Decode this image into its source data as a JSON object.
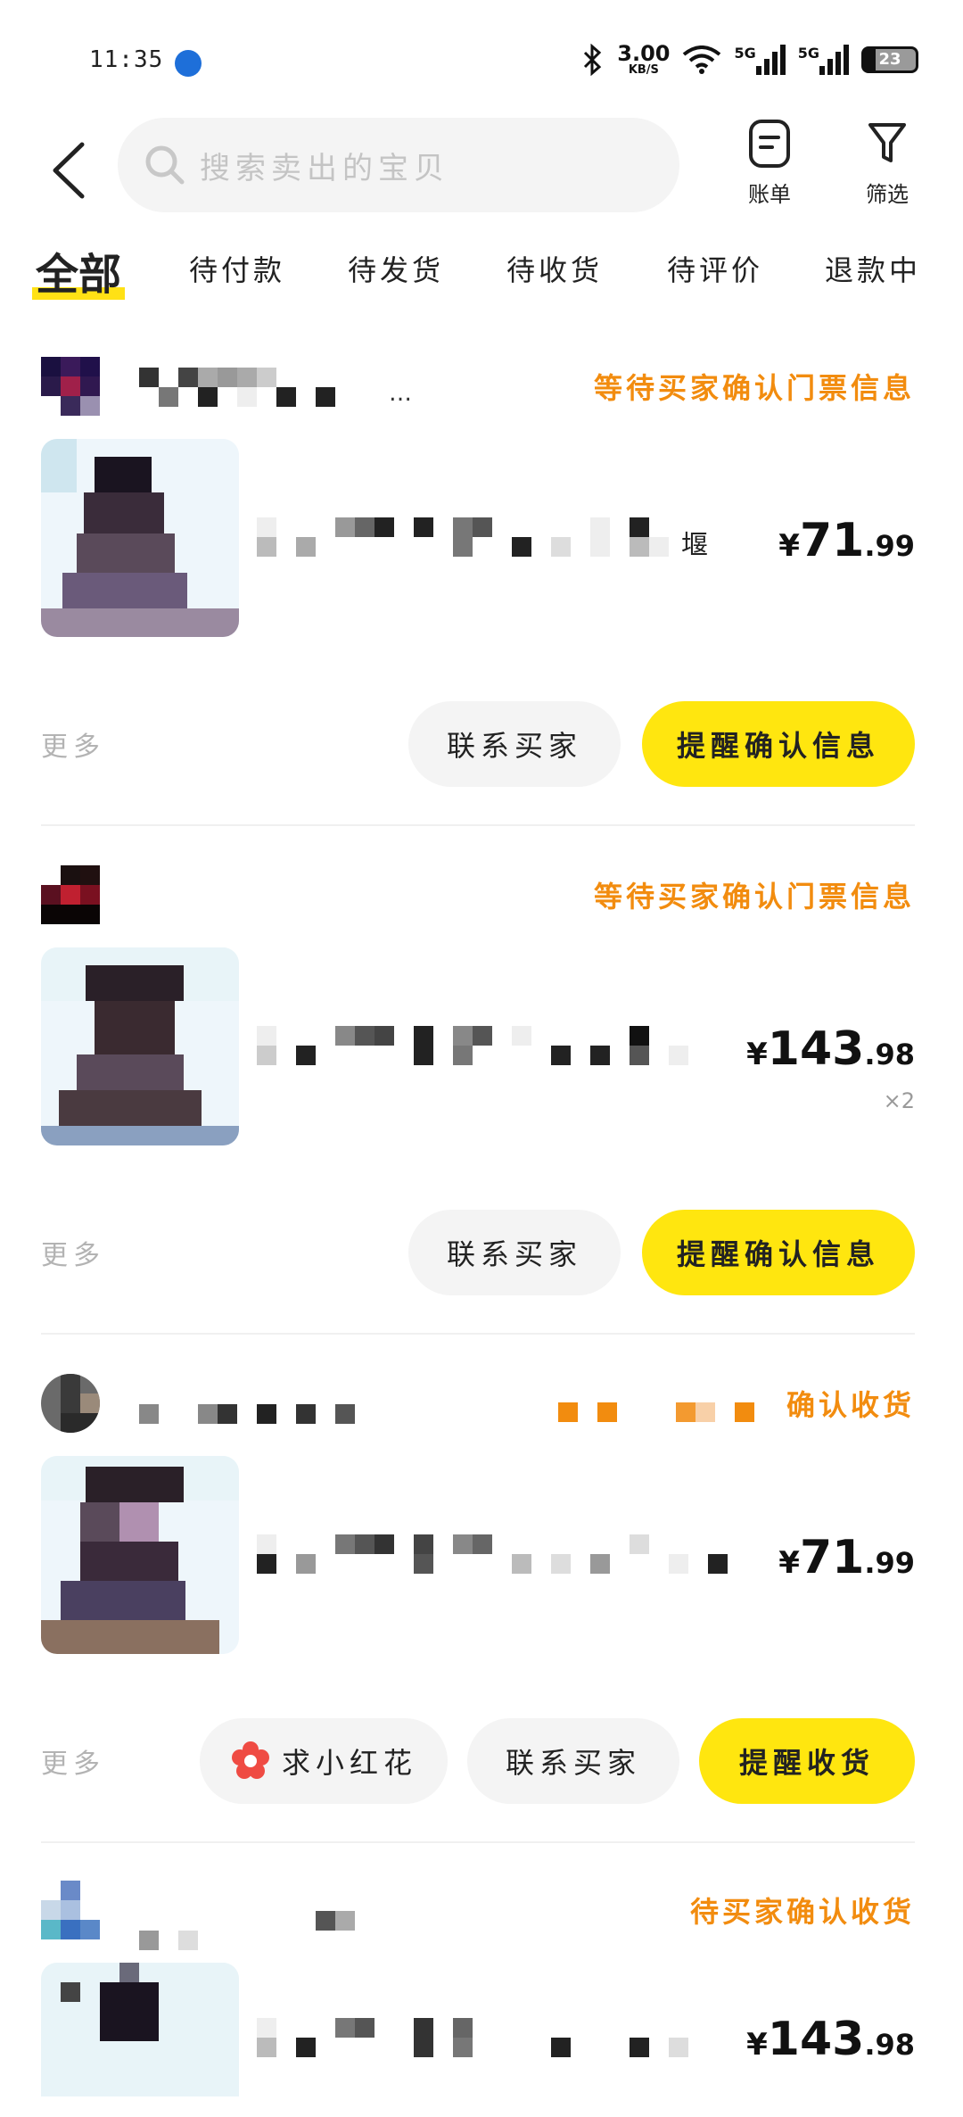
{
  "status_bar": {
    "time": "11:35",
    "net_speed": "3.00",
    "net_unit": "KB/S",
    "signal_1": "5G",
    "signal_2": "5G",
    "battery": "23"
  },
  "header": {
    "search_placeholder": "搜索卖出的宝贝",
    "bill_label": "账单",
    "filter_label": "筛选"
  },
  "tabs": [
    {
      "label": "全部",
      "active": true
    },
    {
      "label": "待付款"
    },
    {
      "label": "待发货"
    },
    {
      "label": "待收货"
    },
    {
      "label": "待评价"
    },
    {
      "label": "退款中"
    }
  ],
  "orders": [
    {
      "status": "等待买家确认门票信息",
      "title_tail": "堰",
      "shop_tail": "…",
      "price": {
        "currency": "¥",
        "int": "71",
        "dec": ".99"
      },
      "more": "更多",
      "buttons": [
        "联系买家",
        "提醒确认信息"
      ]
    },
    {
      "status": "等待买家确认门票信息",
      "price": {
        "currency": "¥",
        "int": "143",
        "dec": ".98"
      },
      "qty": "×2",
      "more": "更多",
      "buttons": [
        "联系买家",
        "提醒确认信息"
      ]
    },
    {
      "status": "确认收货",
      "price": {
        "currency": "¥",
        "int": "71",
        "dec": ".99"
      },
      "more": "更多",
      "buttons": [
        "求小红花",
        "联系买家",
        "提醒收货"
      ]
    },
    {
      "status": "待买家确认收货",
      "price": {
        "currency": "¥",
        "int": "143",
        "dec": ".98"
      }
    }
  ],
  "colors": {
    "accent_yellow": "#ffe60f",
    "status_orange": "#f28c0f"
  },
  "icons": [
    "back-arrow-icon",
    "search-icon",
    "bill-icon",
    "filter-icon",
    "red-flower-icon"
  ]
}
